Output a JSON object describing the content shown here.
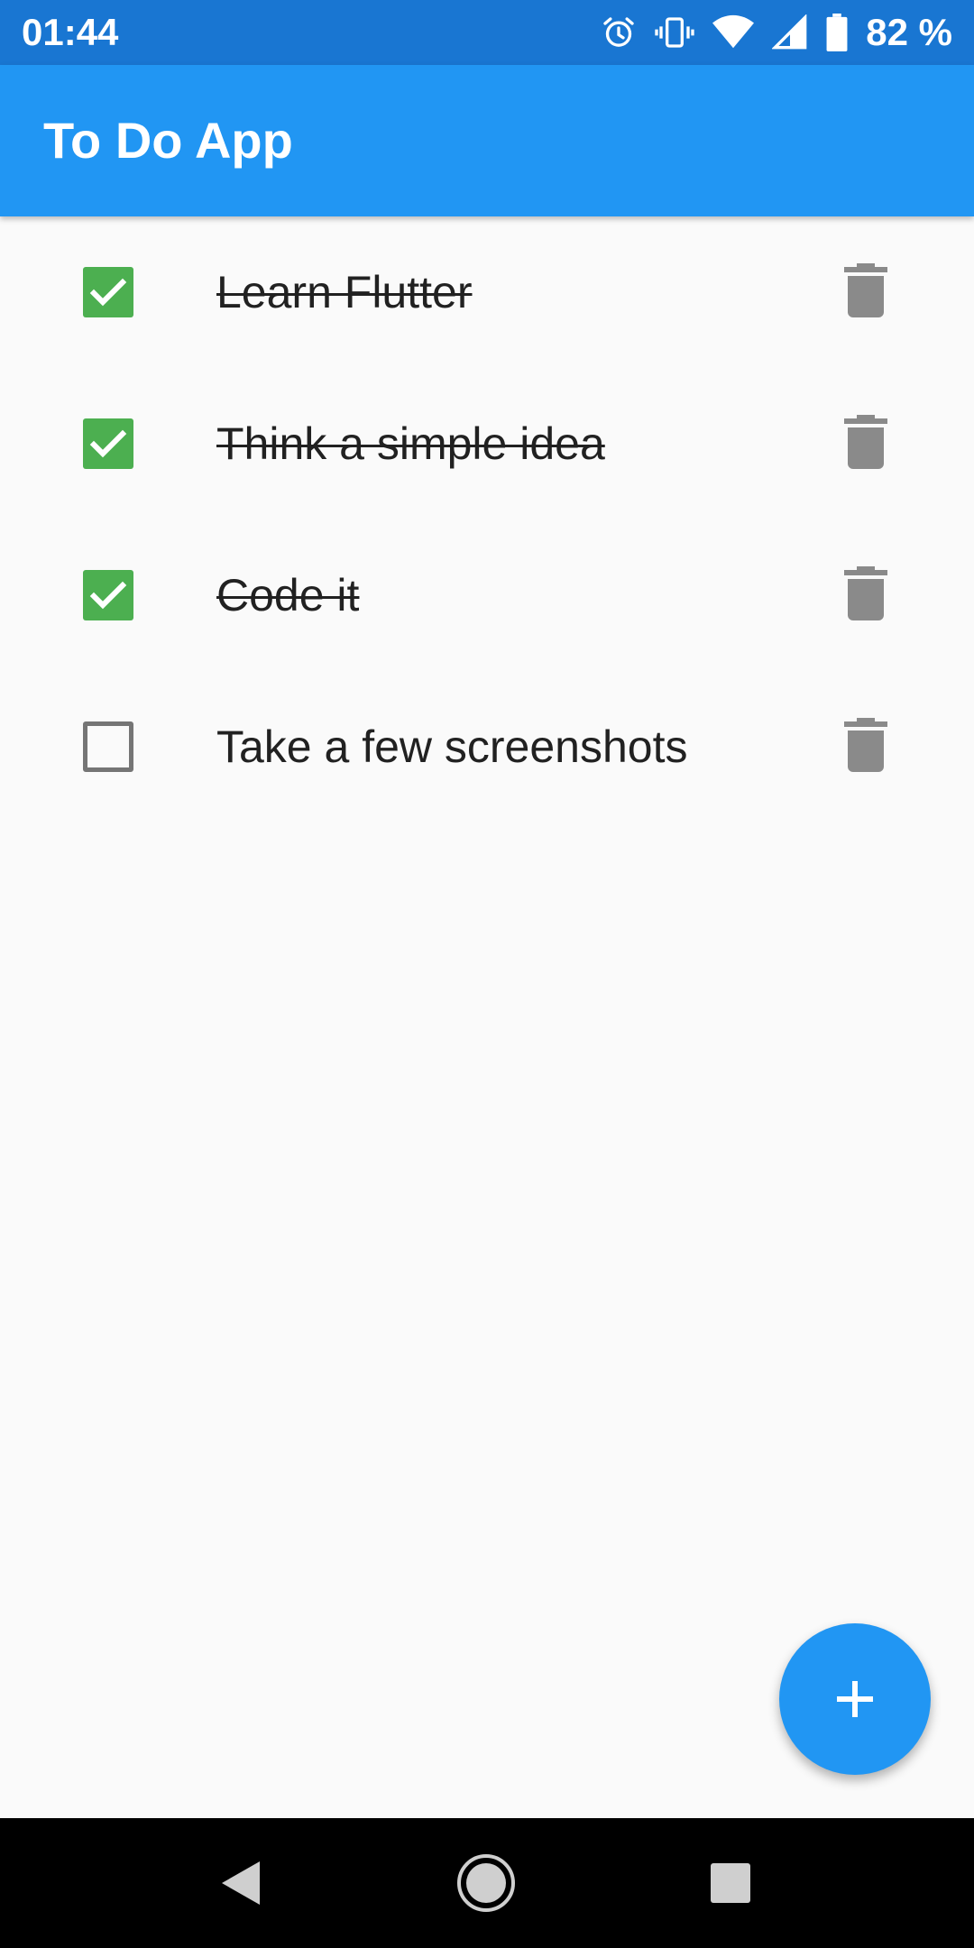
{
  "status_bar": {
    "time": "01:44",
    "battery_percent": "82 %",
    "icons": [
      "alarm-icon",
      "vibrate-icon",
      "wifi-icon",
      "cell-signal-icon",
      "battery-icon"
    ]
  },
  "app_bar": {
    "title": "To Do App",
    "color": "#2196f3"
  },
  "todos": [
    {
      "label": "Learn Flutter",
      "done": true
    },
    {
      "label": "Think a simple idea",
      "done": true
    },
    {
      "label": "Code it",
      "done": true
    },
    {
      "label": "Take a few screenshots",
      "done": false
    }
  ],
  "colors": {
    "status_bar": "#1976d2",
    "checked": "#4caf50",
    "unchecked_border": "#757575",
    "delete_icon": "#8a8a8a",
    "fab": "#2196f3"
  },
  "fab": {
    "icon": "plus-icon"
  },
  "nav_bar": {
    "buttons": [
      "back-icon",
      "home-icon",
      "recents-icon"
    ]
  }
}
